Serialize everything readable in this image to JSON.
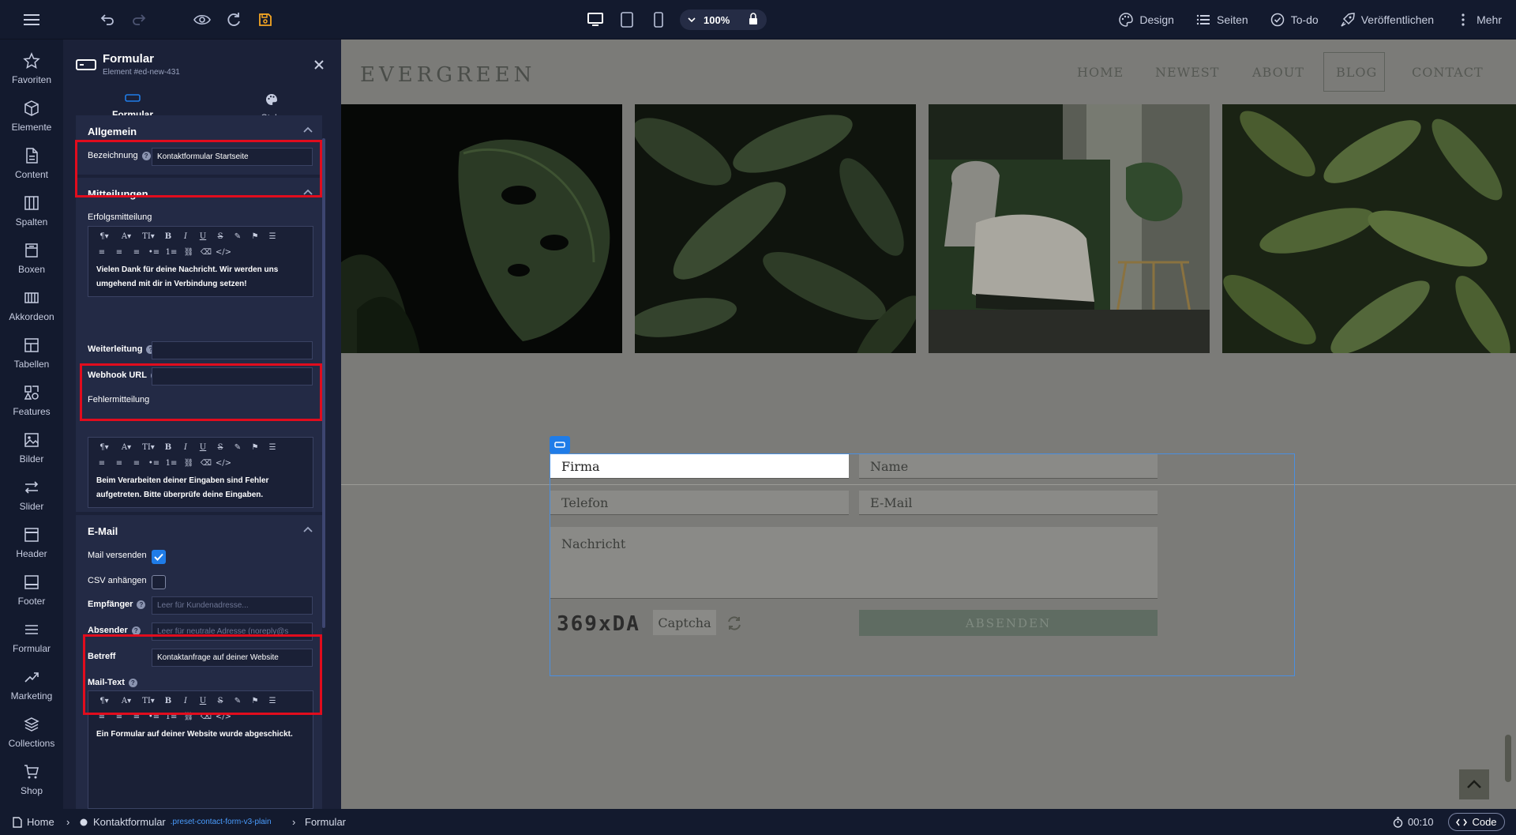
{
  "toolbar": {
    "zoom": "100%",
    "right_links": [
      "Design",
      "Seiten",
      "To-do",
      "Veröffentlichen",
      "Mehr"
    ]
  },
  "sidebar": {
    "items": [
      {
        "label": "Favoriten",
        "icon": "star-icon"
      },
      {
        "label": "Elemente",
        "icon": "cube-icon"
      },
      {
        "label": "Content",
        "icon": "document-icon"
      },
      {
        "label": "Spalten",
        "icon": "columns-icon"
      },
      {
        "label": "Boxen",
        "icon": "box-icon"
      },
      {
        "label": "Akkordeon",
        "icon": "accordion-icon"
      },
      {
        "label": "Tabellen",
        "icon": "table-icon"
      },
      {
        "label": "Features",
        "icon": "features-icon"
      },
      {
        "label": "Bilder",
        "icon": "image-icon"
      },
      {
        "label": "Slider",
        "icon": "slider-icon"
      },
      {
        "label": "Header",
        "icon": "header-icon"
      },
      {
        "label": "Footer",
        "icon": "footer-icon"
      },
      {
        "label": "Formular",
        "icon": "form-list-icon"
      },
      {
        "label": "Marketing",
        "icon": "trend-icon"
      },
      {
        "label": "Collections",
        "icon": "layers-icon"
      },
      {
        "label": "Shop",
        "icon": "cart-icon"
      }
    ]
  },
  "panel": {
    "title": "Formular",
    "subtitle": "Element #ed-new-431",
    "tabs": [
      "Formular",
      "Style"
    ],
    "general": {
      "title": "Allgemein",
      "label_name": "Bezeichnung",
      "value_name": "Kontaktformular Startseite"
    },
    "messages": {
      "title": "Mitteilungen",
      "success_label": "Erfolgsmitteilung",
      "success_text": "Vielen Dank für deine Nachricht. Wir werden uns umgehend mit dir in Verbindung setzen!",
      "redirect_label": "Weiterleitung",
      "webhook_label": "Webhook URL",
      "error_label": "Fehlermitteilung",
      "error_text": "Beim Verarbeiten deiner Eingaben sind Fehler aufgetreten. Bitte überprüfe deine Eingaben."
    },
    "email": {
      "title": "E-Mail",
      "send_mail_label": "Mail versenden",
      "send_mail_checked": true,
      "csv_label": "CSV anhängen",
      "csv_checked": false,
      "recipient_label": "Empfänger",
      "recipient_placeholder": "Leer für Kundenadresse...",
      "sender_label": "Absender",
      "sender_placeholder": "Leer für neutrale Adresse (noreply@s",
      "subject_label": "Betreff",
      "subject_value": "Kontaktanfrage auf deiner Website",
      "mailtext_label": "Mail-Text",
      "mailtext_text": "Ein Formular auf deiner Website wurde abgeschickt."
    }
  },
  "site": {
    "logo": "EVERGREEN",
    "nav": [
      "HOME",
      "NEWEST",
      "ABOUT",
      "BLOG",
      "CONTACT"
    ],
    "active_nav": "BLOG",
    "form": {
      "fields": [
        "Firma",
        "Name",
        "Telefon",
        "E-Mail",
        "Nachricht"
      ],
      "captcha_code": "369xDA",
      "captcha_placeholder": "Captcha",
      "submit": "ABSENDEN"
    }
  },
  "statusbar": {
    "breadcrumb": [
      "Home",
      "Kontaktformular",
      "Formular"
    ],
    "preset_class": ".preset-contact-form-v3-plain",
    "time": "00:10",
    "code_label": "Code"
  },
  "colors": {
    "accent": "#1f7ce8",
    "highlight": "#e10c1d",
    "save_icon": "#f5a623"
  }
}
